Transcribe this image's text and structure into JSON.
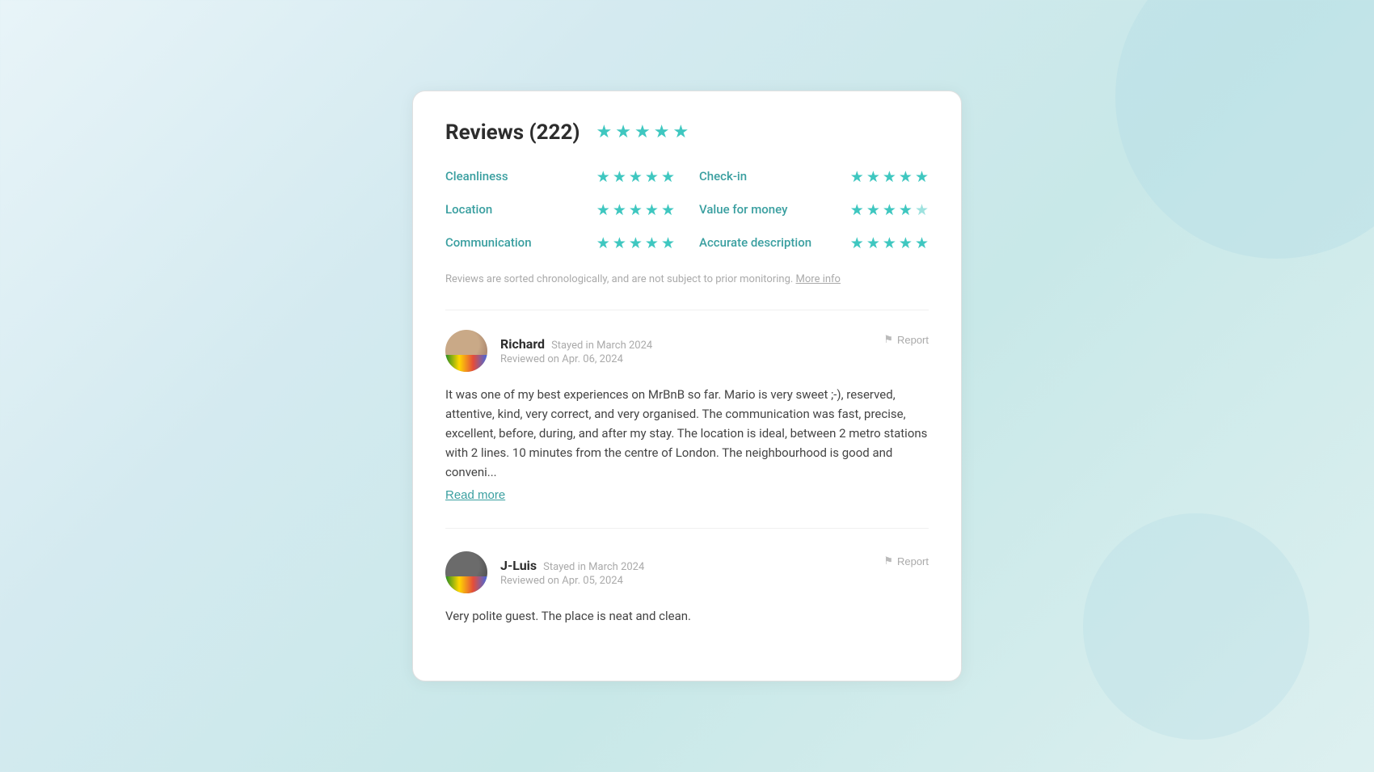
{
  "card": {
    "title": "Reviews (222)",
    "overall_stars": 5,
    "sort_notice": "Reviews are sorted chronologically, and are not subject to prior monitoring.",
    "more_info_label": "More info",
    "ratings": [
      {
        "id": "cleanliness",
        "label": "Cleanliness",
        "stars": 5
      },
      {
        "id": "check-in",
        "label": "Check-in",
        "stars": 5
      },
      {
        "id": "location",
        "label": "Location",
        "stars": 5
      },
      {
        "id": "value-for-money",
        "label": "Value for money",
        "stars": 4
      },
      {
        "id": "communication",
        "label": "Communication",
        "stars": 5
      },
      {
        "id": "accurate-description",
        "label": "Accurate description",
        "stars": 5
      }
    ],
    "reviews": [
      {
        "id": "richard",
        "name": "Richard",
        "stay": "Stayed in March 2024",
        "date": "Reviewed on Apr. 06, 2024",
        "text": "It was one of my best experiences on MrBnB so far. Mario is very sweet ;-), reserved, attentive, kind, very correct, and very organised. The communication was fast, precise, excellent, before, during, and after my stay. The location is ideal, between 2 metro stations with 2 lines. 10 minutes from the centre of London. The neighbourhood is good and conveni...",
        "read_more": "Read more",
        "report_label": "Report",
        "avatar_class": "avatar-richard"
      },
      {
        "id": "j-luis",
        "name": "J-Luis",
        "stay": "Stayed in March 2024",
        "date": "Reviewed on Apr. 05, 2024",
        "text": "Very polite guest. The place is neat and clean.",
        "read_more": null,
        "report_label": "Report",
        "avatar_class": "avatar-jluis"
      }
    ]
  }
}
